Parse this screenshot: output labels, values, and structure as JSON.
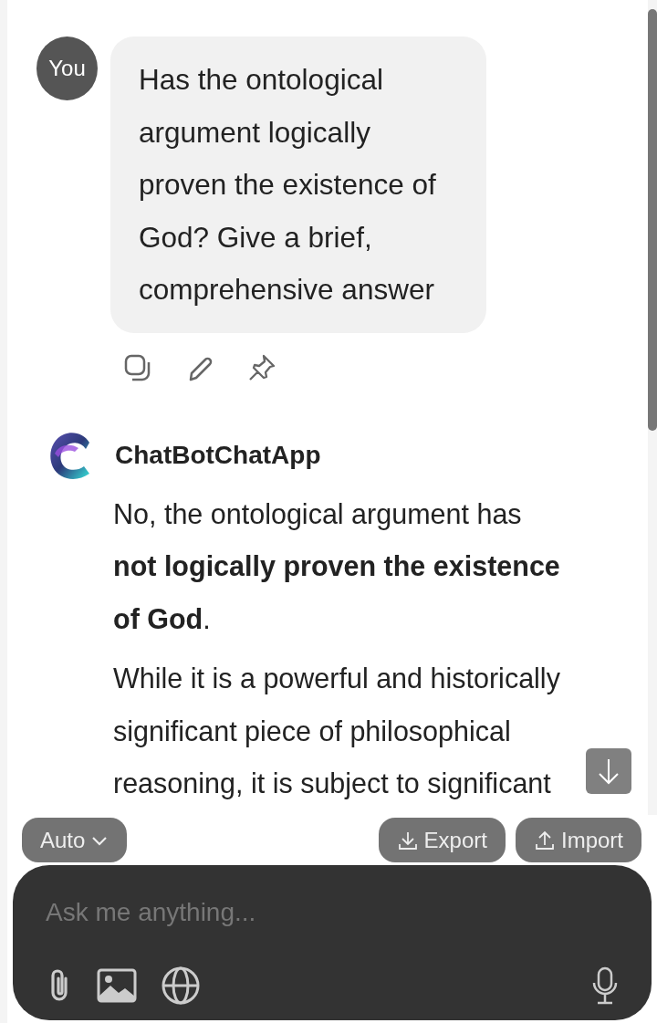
{
  "messages": [
    {
      "kind": "user",
      "author": "You",
      "text": "Has the ontological argument logically proven the existence of God? Give a brief, comprehensive answer",
      "actions": [
        {
          "kind": "copy"
        },
        {
          "kind": "edit"
        },
        {
          "kind": "pin"
        }
      ]
    },
    {
      "kind": "bot",
      "author": "ChatBotChatApp",
      "paragraphs": [
        "No, the ontological argument has **not logically proven the existence of God**.",
        "While it is a powerful and historically significant piece of philosophical reasoning, it is subject to significant"
      ]
    }
  ],
  "toolbar": {
    "mode": "Auto",
    "buttons": [
      {
        "kind": "export",
        "label": "Export"
      },
      {
        "kind": "import",
        "label": "Import"
      }
    ]
  },
  "composer": {
    "placeholder": "Ask me anything..."
  }
}
